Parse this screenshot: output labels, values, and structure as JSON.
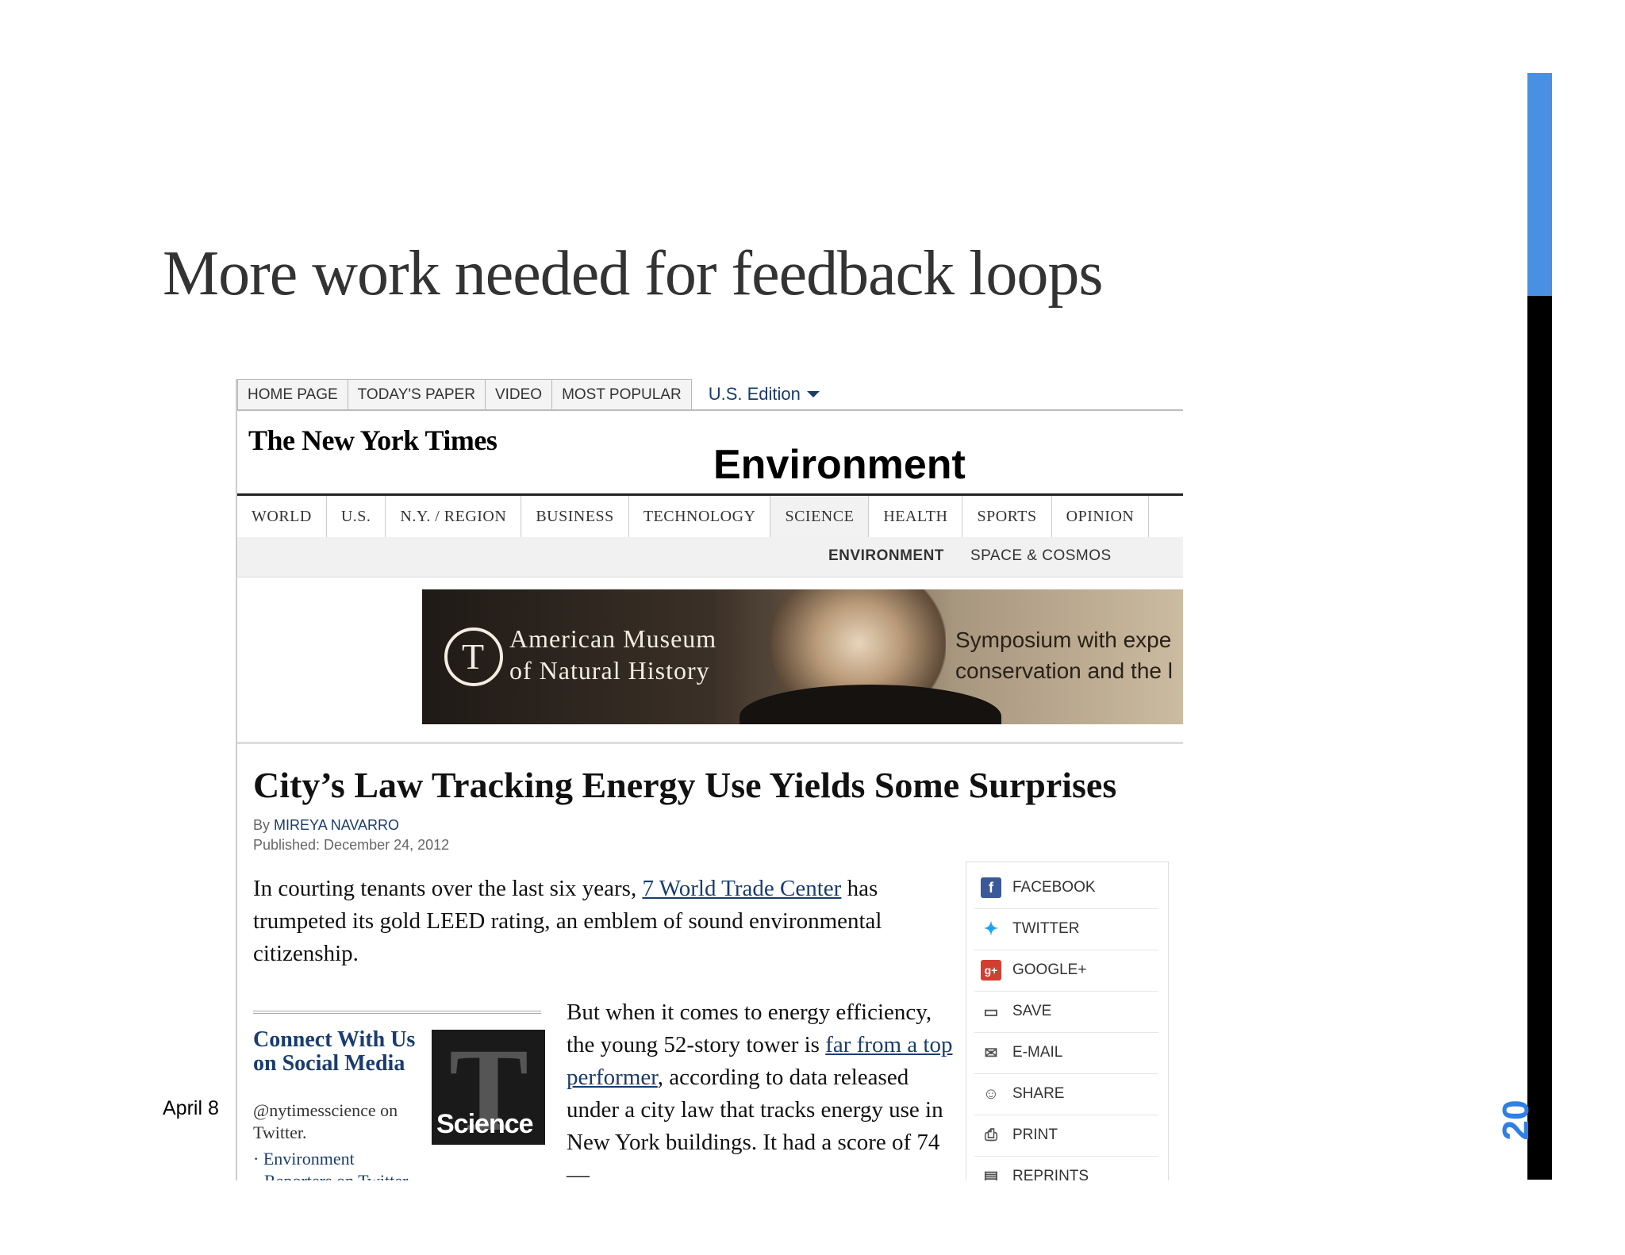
{
  "slide": {
    "title": "More work needed for feedback loops",
    "footer_date": "April 8",
    "page_number": "20"
  },
  "nyt": {
    "top_nav": [
      "HOME PAGE",
      "TODAY'S PAPER",
      "VIDEO",
      "MOST POPULAR"
    ],
    "edition": "U.S. Edition",
    "logo": "The New York Times",
    "section": "Environment",
    "section_nav": [
      "WORLD",
      "U.S.",
      "N.Y. / REGION",
      "BUSINESS",
      "TECHNOLOGY",
      "SCIENCE",
      "HEALTH",
      "SPORTS",
      "OPINION"
    ],
    "section_nav_active": "SCIENCE",
    "sub_nav": [
      "ENVIRONMENT",
      "SPACE & COSMOS"
    ],
    "ad": {
      "org_line1": "American Museum",
      "org_line2": "of Natural History",
      "text_line1": "Symposium with expe",
      "text_line2": "conservation and the l"
    },
    "article": {
      "headline": "City’s Law Tracking Energy Use Yields Some Surprises",
      "by_label": "By",
      "author": "MIREYA NAVARRO",
      "published": "Published: December 24, 2012",
      "lede_before": "In courting tenants over the last six years, ",
      "lede_link": "7 World Trade Center",
      "lede_after": " has trumpeted its gold LEED rating, an emblem of sound environmental citizenship.",
      "body_before": "But when it comes to energy efficiency, the young 52-story tower is ",
      "body_link": "far from a top performer",
      "body_after": ", according to data released under a city law that tracks energy use in New York buildings. It had a score of 74 —"
    },
    "connect": {
      "title": "Connect With Us on Social Media",
      "handle": "@nytimesscience on Twitter.",
      "link1": "Environment",
      "link2": "Reporters on Twitter",
      "badge": "Science"
    },
    "share": [
      {
        "label": "FACEBOOK",
        "icon": "facebook-icon",
        "color": "#3b5998"
      },
      {
        "label": "TWITTER",
        "icon": "twitter-icon",
        "color": "#1da1f2"
      },
      {
        "label": "GOOGLE+",
        "icon": "google-plus-icon",
        "color": "#d23f31"
      },
      {
        "label": "SAVE",
        "icon": "save-icon",
        "color": "#555555"
      },
      {
        "label": "E-MAIL",
        "icon": "email-icon",
        "color": "#555555"
      },
      {
        "label": "SHARE",
        "icon": "share-icon",
        "color": "#555555"
      },
      {
        "label": "PRINT",
        "icon": "print-icon",
        "color": "#555555"
      },
      {
        "label": "REPRINTS",
        "icon": "reprints-icon",
        "color": "#555555"
      }
    ]
  },
  "colors": {
    "accent": "#4a90e2",
    "link": "#1a3c6e",
    "page_number": "#2f7fe6"
  }
}
